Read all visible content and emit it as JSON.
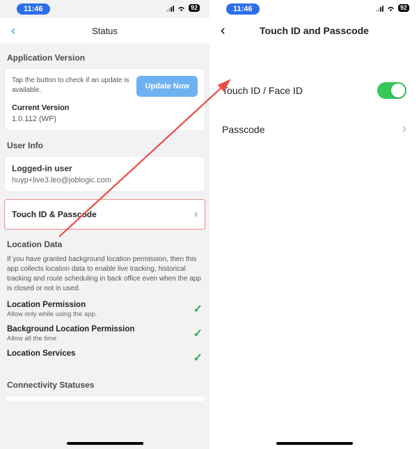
{
  "statusbar": {
    "time": "11:46",
    "battery": "92"
  },
  "left": {
    "title": "Status",
    "appversion": {
      "heading": "Application Version",
      "desc": "Tap the button to check if an update is available.",
      "button": "Update Now",
      "cv_label": "Current Version",
      "cv_value": "1.0.112 (WP)"
    },
    "userinfo": {
      "heading": "User Info",
      "label": "Logged-in user",
      "value": "huyp+live3.leo@joblogic.com"
    },
    "touchpass": {
      "label": "Touch ID & Passcode"
    },
    "location": {
      "heading": "Location Data",
      "desc": "If you have granted background location permission, then this app collects location data to enable live tracking, historical tracking and route scheduling in back office even when the app is closed or not in used.",
      "perm1": {
        "title": "Location Permission",
        "sub": "Allow only while using the app."
      },
      "perm2": {
        "title": "Background Location Permission",
        "sub": "Allow all the time"
      },
      "perm3": {
        "title": "Location Services"
      }
    },
    "connectivity": {
      "heading": "Connectivity Statuses"
    }
  },
  "right": {
    "title": "Touch ID and Passcode",
    "row1": "Touch ID / Face ID",
    "row2": "Passcode"
  }
}
